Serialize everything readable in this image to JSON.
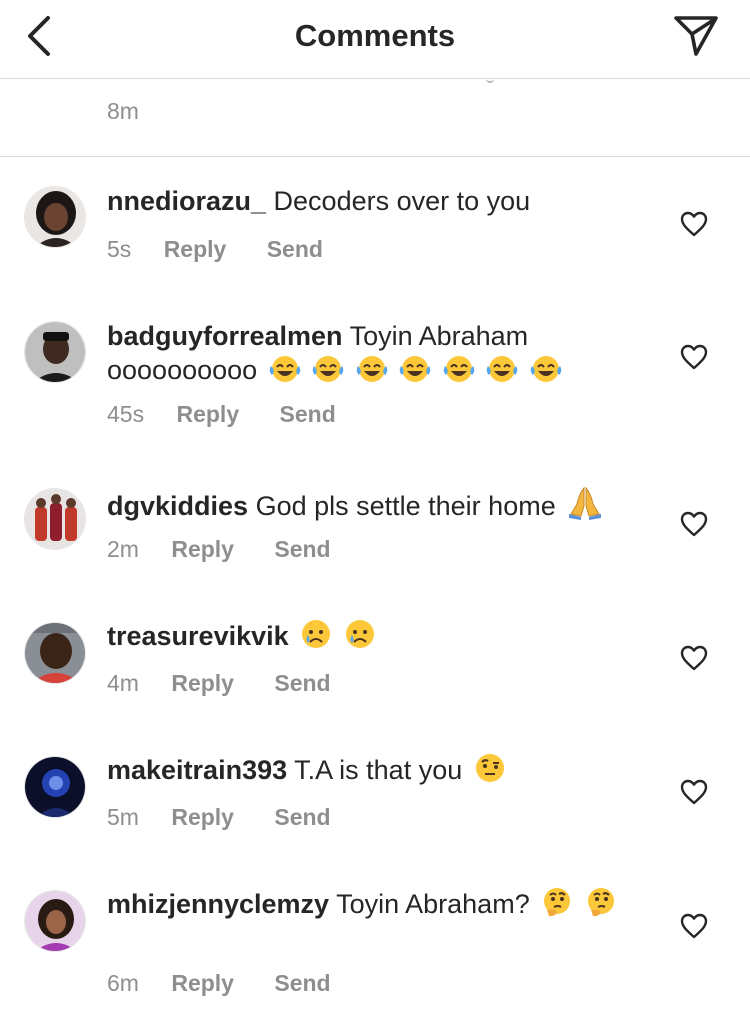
{
  "header": {
    "title": "Comments",
    "back_icon": "chevron-left-icon",
    "share_icon": "paper-plane-icon"
  },
  "previous_comment": {
    "time": "8m"
  },
  "actions": {
    "reply": "Reply",
    "send": "Send"
  },
  "comments": [
    {
      "username": "nnediorazu_",
      "text": "Decoders over to you",
      "emojis": [],
      "time": "5s"
    },
    {
      "username": "badguyforrealmen",
      "text": "Toyin Abraham oooooooooo",
      "emojis": [
        "tears-of-joy",
        "tears-of-joy",
        "tears-of-joy",
        "tears-of-joy",
        "tears-of-joy",
        "tears-of-joy",
        "tears-of-joy"
      ],
      "time": "45s"
    },
    {
      "username": "dgvkiddies",
      "text": "God pls settle their home",
      "emojis": [
        "folded-hands"
      ],
      "time": "2m"
    },
    {
      "username": "treasurevikvik",
      "text": "",
      "emojis": [
        "crying-face",
        "crying-face"
      ],
      "time": "4m"
    },
    {
      "username": "makeitrain393",
      "text": "T.A is that you",
      "emojis": [
        "raised-eyebrow-face"
      ],
      "time": "5m"
    },
    {
      "username": "mhizjennyclemzy",
      "text": "Toyin Abraham?",
      "emojis": [
        "thinking-face",
        "thinking-face"
      ],
      "time": "6m"
    }
  ],
  "colors": {
    "text": "#262626",
    "secondary": "#8e8e8e",
    "divider": "#dbdbdb",
    "emoji_yellow": "#fdc73a"
  }
}
